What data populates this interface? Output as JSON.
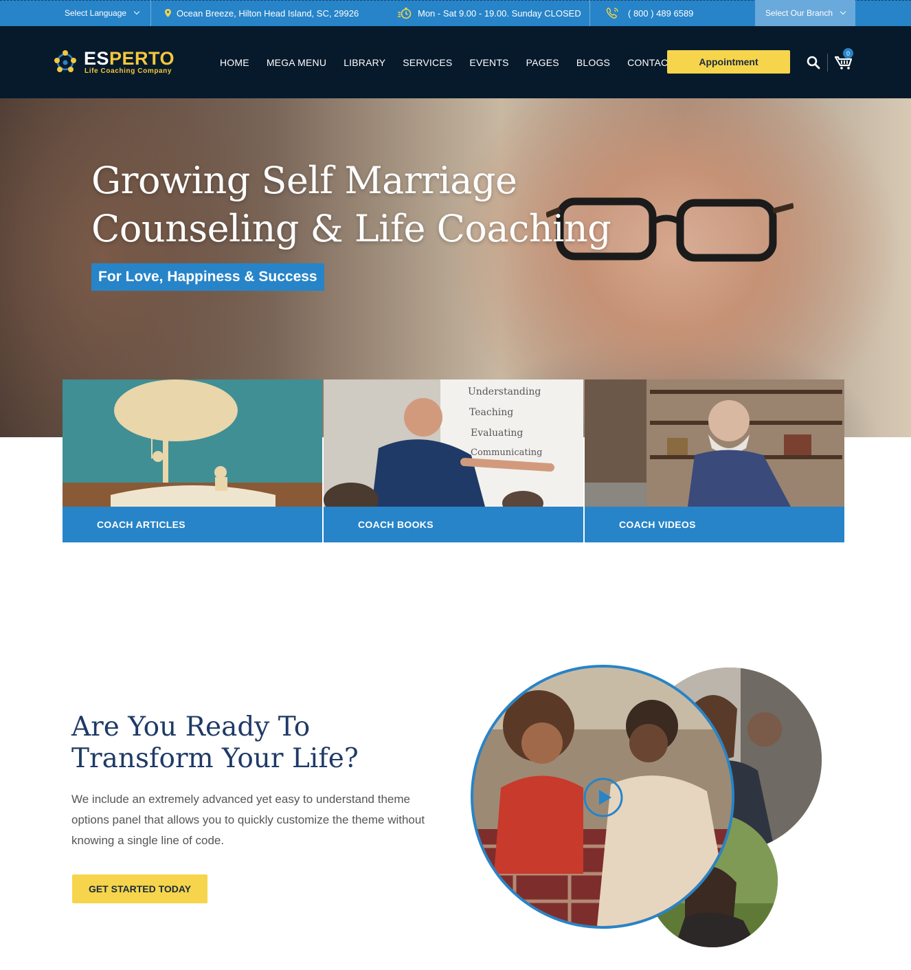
{
  "topbar": {
    "language": "Select Language",
    "address": "Ocean Breeze, Hilton Head Island, SC, 29926",
    "hours": "Mon - Sat 9.00 - 19.00. Sunday CLOSED",
    "phone": "( 800 ) 489 6589",
    "branch": "Select Our Branch"
  },
  "brand": {
    "name_part1": "ES",
    "name_part2": "PERTO",
    "tagline": "Life Coaching Company",
    "accent": "#f4c73c"
  },
  "nav": {
    "items": [
      "HOME",
      "MEGA MENU",
      "LIBRARY",
      "SERVICES",
      "EVENTS",
      "PAGES",
      "BLOGS",
      "CONTACT US"
    ],
    "appointment": "Appointment",
    "cart_count": "0"
  },
  "hero": {
    "title_line1": "Growing Self Marriage",
    "title_line2": "Counseling & Life Coaching",
    "tag": "For Love, Happiness & Success"
  },
  "cards": [
    {
      "label": "COACH ARTICLES"
    },
    {
      "label": "COACH BOOKS"
    },
    {
      "label": "COACH VIDEOS"
    }
  ],
  "transform": {
    "title_line1": "Are You Ready To",
    "title_line2": "Transform Your Life?",
    "body": "We include an extremely advanced yet easy to understand theme options panel that allows you to quickly customize the theme without knowing a single line of code.",
    "button": "GET STARTED TODAY"
  },
  "colors": {
    "primary_blue": "#2784c8",
    "nav_dark": "#071a2c",
    "yellow": "#f6d54c",
    "heading_navy": "#1e3a66"
  },
  "icons": [
    "chevron-down-icon",
    "map-pin-icon",
    "clock-icon",
    "phone-icon",
    "search-icon",
    "cart-icon",
    "play-icon"
  ]
}
